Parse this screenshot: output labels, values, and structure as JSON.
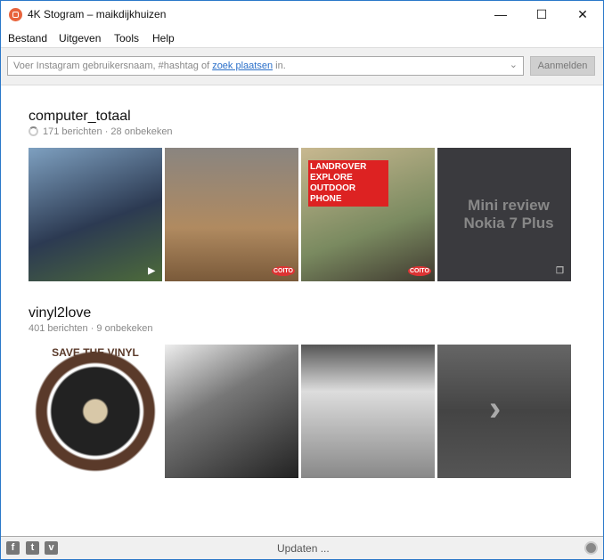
{
  "window": {
    "title": "4K Stogram – maikdijkhuizen",
    "minimize": "—",
    "maximize": "☐",
    "close": "✕"
  },
  "menu": [
    "Bestand",
    "Uitgeven",
    "Tools",
    "Help"
  ],
  "search": {
    "placeholder_prefix": "Voer Instagram gebruikersnaam, #hashtag of ",
    "link": "zoek plaatsen",
    "placeholder_suffix": " in.",
    "dropdown": "⌄"
  },
  "login_button": "Aanmelden",
  "sections": [
    {
      "name": "computer_totaal",
      "sub": "171 berichten · 28 onbekeken",
      "thumbs": [
        {
          "overlay": "",
          "badge": "▶"
        },
        {
          "overlay": "",
          "badge": "COITO"
        },
        {
          "overlay": "LANDROVER EXPLORE OUTDOOR PHONE",
          "badge": "COITO"
        },
        {
          "overlay": "Mini review Nokia 7 Plus",
          "badge": "❐"
        }
      ]
    },
    {
      "name": "vinyl2love",
      "sub": "401 berichten · 9 onbekeken",
      "thumbs": [
        {
          "overlay": "SAVE THE VINYL"
        },
        {
          "overlay": ""
        },
        {
          "overlay": ""
        },
        {
          "overlay": ""
        }
      ]
    }
  ],
  "status": {
    "text": "Updaten ...",
    "social": [
      "f",
      "t",
      "v"
    ]
  }
}
